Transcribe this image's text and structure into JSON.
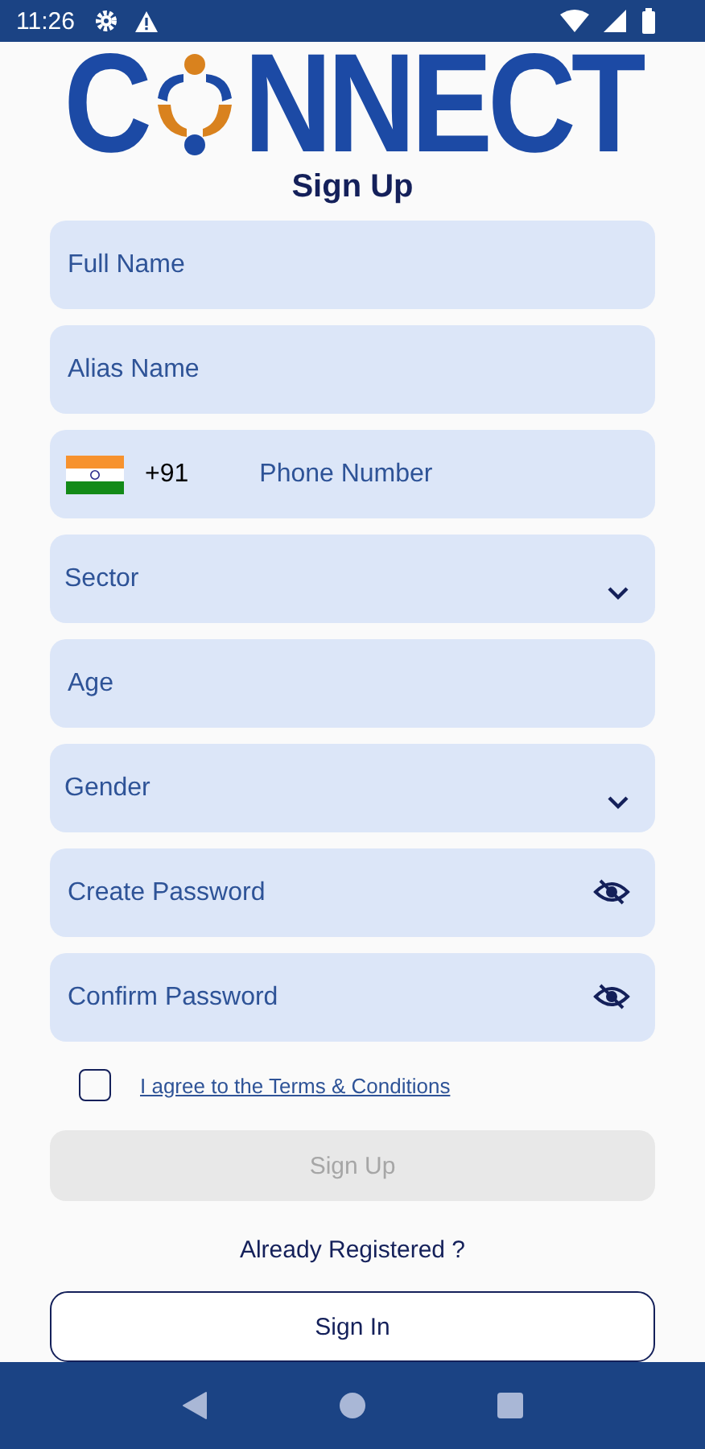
{
  "status_bar": {
    "time": "11:26"
  },
  "logo": {
    "first": "C",
    "rest": "NNECT"
  },
  "title": "Sign Up",
  "fields": [
    {
      "kind": "text",
      "placeholder": "Full Name"
    },
    {
      "kind": "text",
      "placeholder": "Alias Name"
    },
    {
      "kind": "phone",
      "code": "+91",
      "placeholder": "Phone Number"
    },
    {
      "kind": "select",
      "placeholder": "Sector"
    },
    {
      "kind": "text",
      "placeholder": "Age"
    },
    {
      "kind": "select",
      "placeholder": "Gender"
    },
    {
      "kind": "password",
      "placeholder": "Create Password"
    },
    {
      "kind": "password",
      "placeholder": "Confirm Password"
    }
  ],
  "terms": {
    "checked": false,
    "label": "I agree to the Terms & Conditions"
  },
  "signup_button": {
    "label": "Sign Up",
    "disabled": true
  },
  "already": "Already Registered ?",
  "signin_button": {
    "label": "Sign In"
  }
}
